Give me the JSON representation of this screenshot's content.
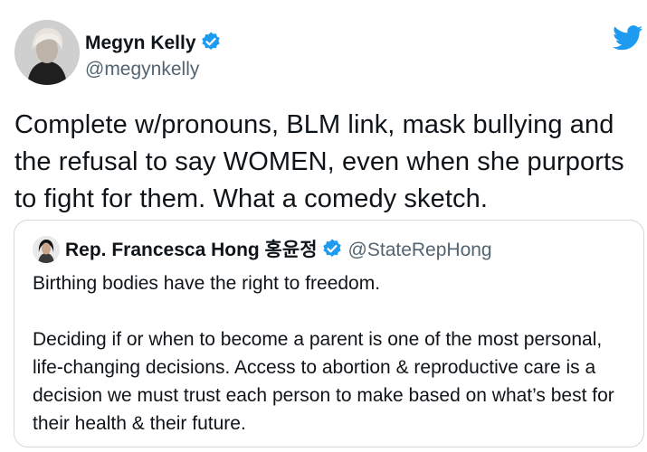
{
  "tweet": {
    "author": {
      "name": "Megyn Kelly",
      "handle": "@megynkelly",
      "verified": true,
      "avatar_icon": "profile-photo"
    },
    "text": "Complete w/pronouns, BLM link, mask bullying and the refusal to say WOMEN, even when she purports to fight for them. What a comedy sketch.",
    "brand_icon": "twitter-bird-icon",
    "brand_color": "#1d9bf0"
  },
  "quoted_tweet": {
    "author": {
      "name": "Rep. Francesca Hong 홍윤정",
      "handle": "@StateRepHong",
      "verified": true,
      "avatar_icon": "profile-photo"
    },
    "paragraphs": [
      "Birthing bodies have the right to freedom.",
      "Deciding if or when to become a parent is one of the most personal, life-changing decisions. Access to abortion & reproductive care is a decision we must trust each person to make based on what’s best for their health & their future."
    ]
  },
  "colors": {
    "text_primary": "#0f1419",
    "text_secondary": "#536471",
    "verified_badge": "#1d9bf0",
    "card_border": "#cfd9de"
  }
}
